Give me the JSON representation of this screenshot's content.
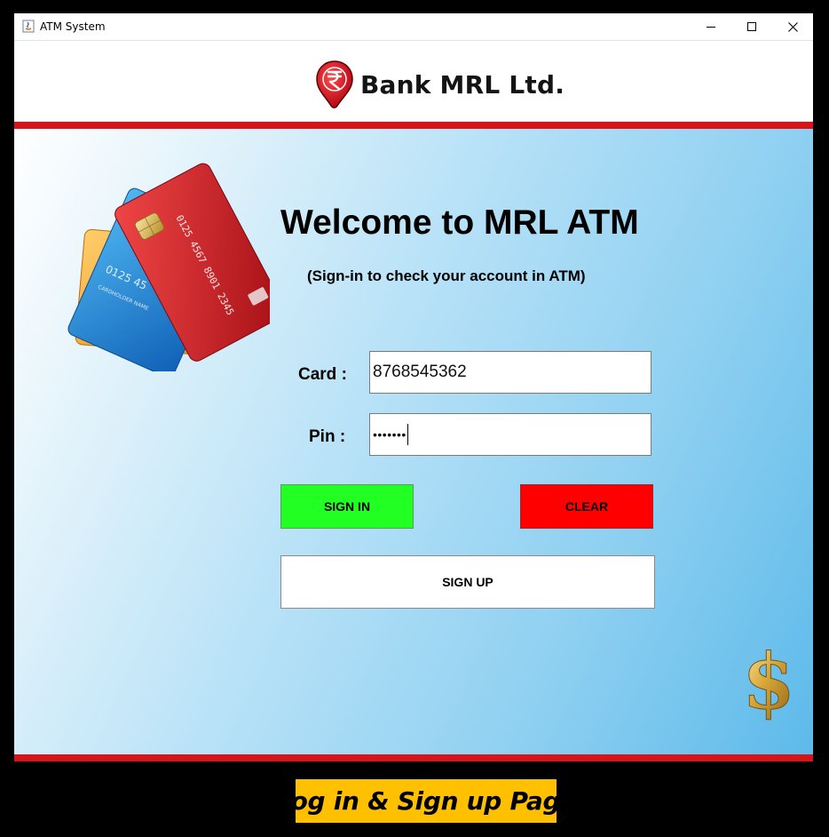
{
  "window": {
    "title": "ATM System",
    "icons": [
      "java-app-icon",
      "minimize-icon",
      "maximize-icon",
      "close-icon"
    ]
  },
  "header": {
    "brand": "Bank MRL Ltd.",
    "logo_icon": "rupee-logo-icon",
    "colors": {
      "accent_red": "#d8141b"
    }
  },
  "main": {
    "title": "Welcome to MRL ATM",
    "subtitle": "(Sign-in to check your account in ATM)",
    "card_label": "Card :",
    "card_value": "8768545362",
    "pin_label": "Pin :",
    "pin_value": "•••••••",
    "buttons": {
      "sign_in": "SIGN IN",
      "clear": "CLEAR",
      "sign_up": "SIGN UP"
    },
    "colors": {
      "sign_in": "#22ff22",
      "clear": "#ff0000",
      "sign_up": "#ffffff"
    },
    "decor_icons": [
      "credit-cards-illustration",
      "dollar-sign-icon"
    ]
  },
  "caption": {
    "text": "Log in & Sign up Page",
    "color": "#ffc000"
  }
}
